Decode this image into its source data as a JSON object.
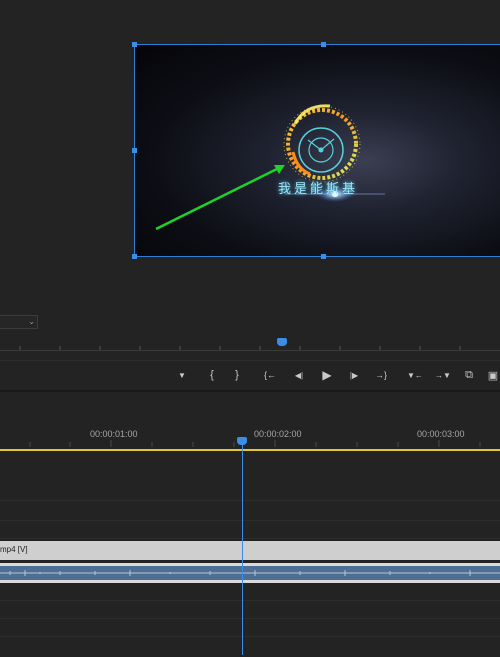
{
  "program_monitor": {
    "overlay_text": "我是能斯基",
    "zoom_dropdown_value": ""
  },
  "transport": {
    "buttons": [
      {
        "name": "add-marker-button",
        "glyph": "▼"
      },
      {
        "name": "mark-in-button",
        "glyph": "{"
      },
      {
        "name": "mark-out-button",
        "glyph": "}"
      },
      {
        "name": "go-to-in-button",
        "glyph": "{←"
      },
      {
        "name": "step-back-button",
        "glyph": "◀|"
      },
      {
        "name": "play-button",
        "glyph": "▶"
      },
      {
        "name": "step-forward-button",
        "glyph": "|▶"
      },
      {
        "name": "go-to-out-button",
        "glyph": "→}"
      },
      {
        "name": "lift-button",
        "glyph": "▼←"
      },
      {
        "name": "extract-button",
        "glyph": "→▼"
      },
      {
        "name": "export-frame-button",
        "glyph": "⧉"
      },
      {
        "name": "comparison-view-button",
        "glyph": "▣"
      }
    ]
  },
  "timeline": {
    "timecodes": [
      "00:00:01:00",
      "00:00:02:00",
      "00:00:03:00"
    ],
    "video_clip_label": "mp4 [V]",
    "playhead_position_seconds": 2
  },
  "colors": {
    "accent": "#3a8ee6",
    "work_area": "#e2c63a",
    "audio_clip": "#4e6f93",
    "video_clip": "#cfcfcf"
  }
}
